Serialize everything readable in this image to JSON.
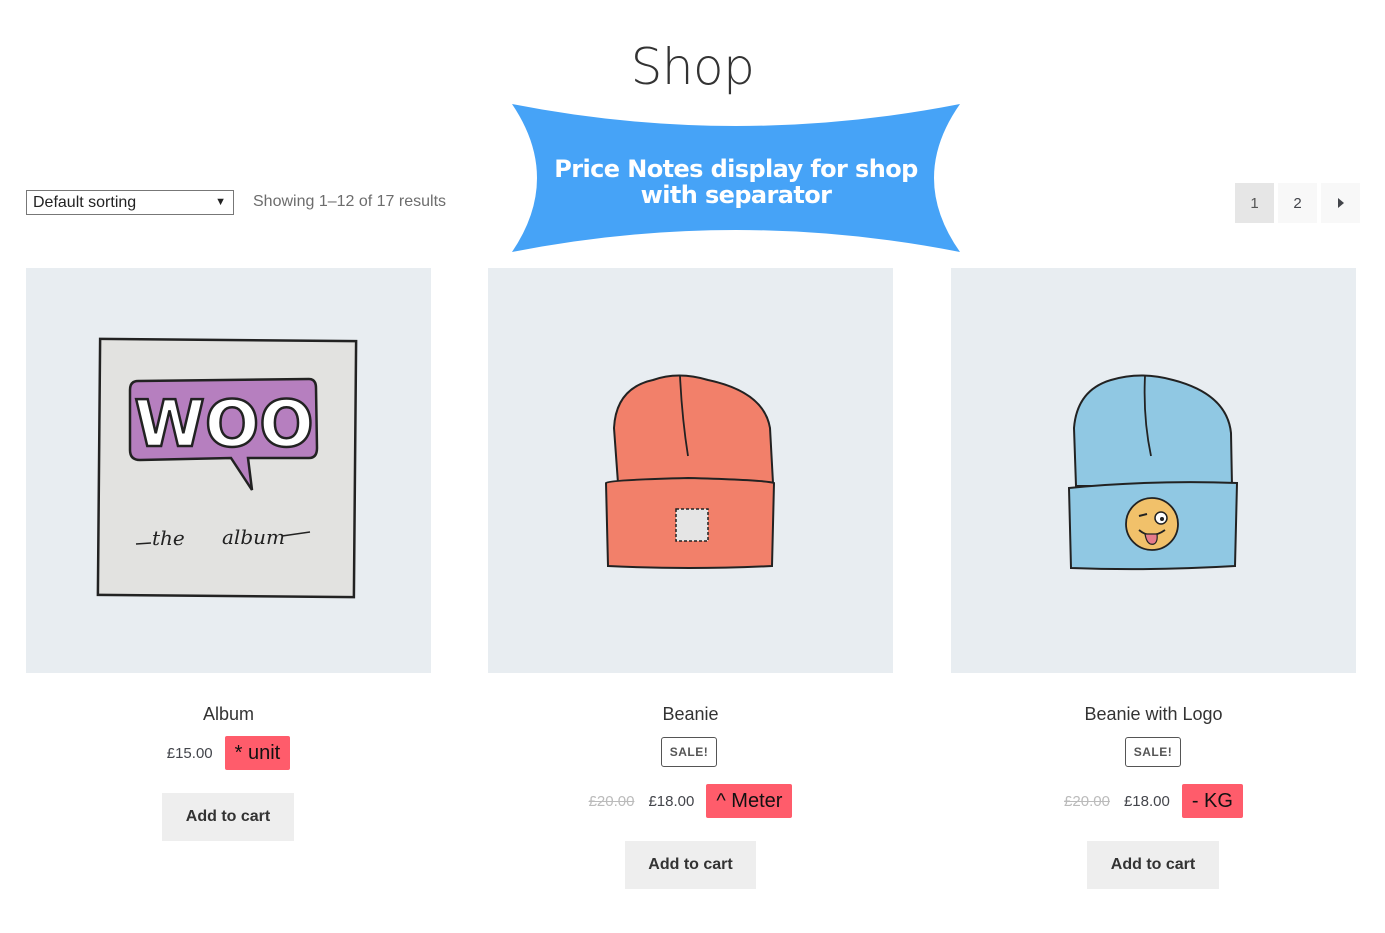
{
  "page": {
    "title": "Shop"
  },
  "banner": {
    "text": "Price Notes display for shop with separator",
    "color": "#46a3f7"
  },
  "toolbar": {
    "sort_selected": "Default sorting",
    "result_count": "Showing 1–12 of 17 results",
    "pagination": {
      "pages": [
        "1",
        "2"
      ],
      "current": "1",
      "next_icon": "triangle-right-icon"
    }
  },
  "products": [
    {
      "name": "Album",
      "price": "£15.00",
      "note": "* unit",
      "button": "Add to cart",
      "image": "woo-album-illustration"
    },
    {
      "name": "Beanie",
      "sale": "SALE!",
      "old_price": "£20.00",
      "price": "£18.00",
      "note": "^ Meter",
      "button": "Add to cart",
      "image": "orange-beanie-illustration"
    },
    {
      "name": "Beanie with Logo",
      "sale": "SALE!",
      "old_price": "£20.00",
      "price": "£18.00",
      "note": "- KG",
      "button": "Add to cart",
      "image": "blue-beanie-logo-illustration"
    }
  ],
  "colors": {
    "note_bg": "#ff5c6b",
    "image_bg": "#e8edf1",
    "button_bg": "#eeeeee"
  }
}
